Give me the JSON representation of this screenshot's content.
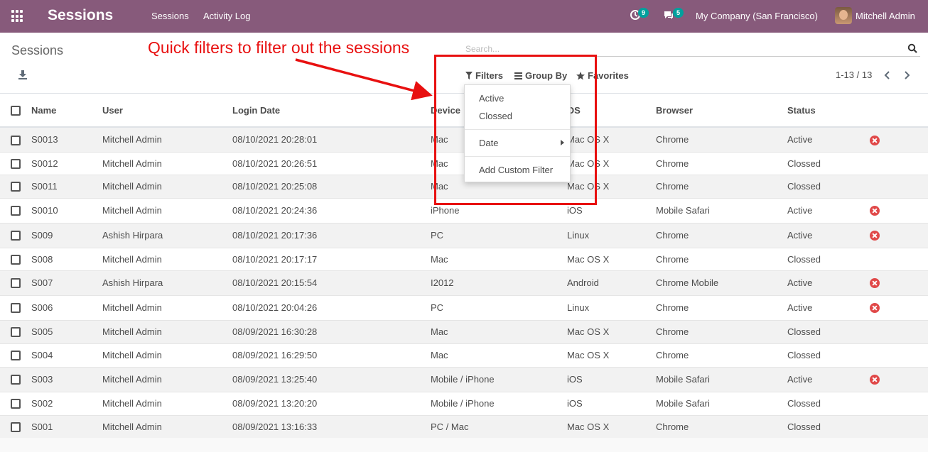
{
  "navbar": {
    "app_name": "Sessions",
    "menu": [
      "Sessions",
      "Activity Log"
    ],
    "activity_badge": "9",
    "messages_badge": "5",
    "company": "My Company (San Francisco)",
    "user": "Mitchell Admin",
    "color": "#875a7b"
  },
  "control_panel": {
    "title": "Sessions",
    "search_placeholder": "Search...",
    "filters_label": "Filters",
    "groupby_label": "Group By",
    "favorites_label": "Favorites",
    "pager": "1-13 / 13"
  },
  "filter_menu": {
    "items": [
      "Active",
      "Clossed",
      "Date",
      "Add Custom Filter"
    ]
  },
  "annotation": {
    "text": "Quick filters to filter out the sessions",
    "color": "#e81010"
  },
  "table": {
    "columns": [
      "Name",
      "User",
      "Login Date",
      "Device",
      "OS",
      "Browser",
      "Status"
    ],
    "rows": [
      {
        "name": "S0013",
        "user": "Mitchell Admin",
        "login_date": "08/10/2021 20:28:01",
        "device": "Mac",
        "os": "Mac OS X",
        "browser": "Chrome",
        "status": "Active",
        "close": true
      },
      {
        "name": "S0012",
        "user": "Mitchell Admin",
        "login_date": "08/10/2021 20:26:51",
        "device": "Mac",
        "os": "Mac OS X",
        "browser": "Chrome",
        "status": "Clossed",
        "close": false
      },
      {
        "name": "S0011",
        "user": "Mitchell Admin",
        "login_date": "08/10/2021 20:25:08",
        "device": "Mac",
        "os": "Mac OS X",
        "browser": "Chrome",
        "status": "Clossed",
        "close": false
      },
      {
        "name": "S0010",
        "user": "Mitchell Admin",
        "login_date": "08/10/2021 20:24:36",
        "device": "iPhone",
        "os": "iOS",
        "browser": "Mobile Safari",
        "status": "Active",
        "close": true
      },
      {
        "name": "S009",
        "user": "Ashish Hirpara",
        "login_date": "08/10/2021 20:17:36",
        "device": "PC",
        "os": "Linux",
        "browser": "Chrome",
        "status": "Active",
        "close": true
      },
      {
        "name": "S008",
        "user": "Mitchell Admin",
        "login_date": "08/10/2021 20:17:17",
        "device": "Mac",
        "os": "Mac OS X",
        "browser": "Chrome",
        "status": "Clossed",
        "close": false
      },
      {
        "name": "S007",
        "user": "Ashish Hirpara",
        "login_date": "08/10/2021 20:15:54",
        "device": "I2012",
        "os": "Android",
        "browser": "Chrome Mobile",
        "status": "Active",
        "close": true
      },
      {
        "name": "S006",
        "user": "Mitchell Admin",
        "login_date": "08/10/2021 20:04:26",
        "device": "PC",
        "os": "Linux",
        "browser": "Chrome",
        "status": "Active",
        "close": true
      },
      {
        "name": "S005",
        "user": "Mitchell Admin",
        "login_date": "08/09/2021 16:30:28",
        "device": "Mac",
        "os": "Mac OS X",
        "browser": "Chrome",
        "status": "Clossed",
        "close": false
      },
      {
        "name": "S004",
        "user": "Mitchell Admin",
        "login_date": "08/09/2021 16:29:50",
        "device": "Mac",
        "os": "Mac OS X",
        "browser": "Chrome",
        "status": "Clossed",
        "close": false
      },
      {
        "name": "S003",
        "user": "Mitchell Admin",
        "login_date": "08/09/2021 13:25:40",
        "device": "Mobile / iPhone",
        "os": "iOS",
        "browser": "Mobile Safari",
        "status": "Active",
        "close": true
      },
      {
        "name": "S002",
        "user": "Mitchell Admin",
        "login_date": "08/09/2021 13:20:20",
        "device": "Mobile / iPhone",
        "os": "iOS",
        "browser": "Mobile Safari",
        "status": "Clossed",
        "close": false
      },
      {
        "name": "S001",
        "user": "Mitchell Admin",
        "login_date": "08/09/2021 13:16:33",
        "device": "PC / Mac",
        "os": "Mac OS X",
        "browser": "Chrome",
        "status": "Clossed",
        "close": false
      }
    ]
  }
}
